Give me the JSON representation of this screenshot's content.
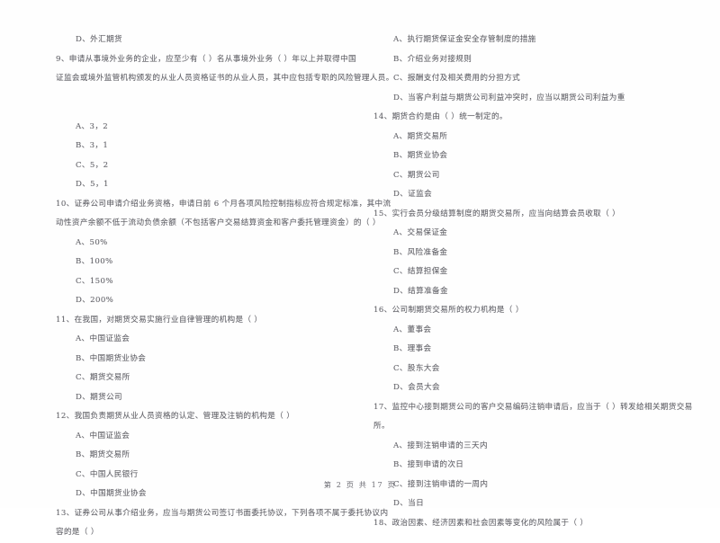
{
  "document": {
    "footer": "第 2 页 共 17 页"
  },
  "left_column": {
    "blocks": [
      {
        "kind": "option",
        "text": "D、外汇期货"
      },
      {
        "kind": "question",
        "text": "9、申请从事境外业务的企业，应至少有（      ）名从事境外业务（      ）年以上并取得中国"
      },
      {
        "kind": "cont",
        "text": "证监会或境外监管机构颁发的从业人员资格证书的从业人员，其中应包括专职的风险管理人员。"
      },
      {
        "kind": "gap-lg",
        "text": ""
      },
      {
        "kind": "option",
        "text": "A、3，2"
      },
      {
        "kind": "option",
        "text": "B、3，1"
      },
      {
        "kind": "option",
        "text": "C、5，2"
      },
      {
        "kind": "option",
        "text": "D、5，1"
      },
      {
        "kind": "question",
        "text": "10、证券公司申请介绍业务资格，申请日前 6 个月各项风险控制指标应符合规定标准，其中流"
      },
      {
        "kind": "cont",
        "text": "动性资产余额不低于流动负债余额（不包括客户交易结算资金和客户委托管理资金）的（      ）"
      },
      {
        "kind": "option",
        "text": "A、50%"
      },
      {
        "kind": "option",
        "text": "B、100%"
      },
      {
        "kind": "option",
        "text": "C、150%"
      },
      {
        "kind": "option",
        "text": "D、200%"
      },
      {
        "kind": "question",
        "text": "11、在我国，对期货交易实施行业自律管理的机构是（      ）"
      },
      {
        "kind": "option",
        "text": "A、中国证监会"
      },
      {
        "kind": "option",
        "text": "B、中国期货业协会"
      },
      {
        "kind": "option",
        "text": "C、期货交易所"
      },
      {
        "kind": "option",
        "text": "D、期货公司"
      },
      {
        "kind": "question",
        "text": "12、我国负责期货从业人员资格的认定、管理及注销的机构是（      ）"
      },
      {
        "kind": "option",
        "text": "A、中国证监会"
      },
      {
        "kind": "option",
        "text": "B、期货交易所"
      },
      {
        "kind": "option",
        "text": "C、中国人民银行"
      },
      {
        "kind": "option",
        "text": "D、中国期货业协会"
      },
      {
        "kind": "question",
        "text": "13、证券公司从事介绍业务，应当与期货公司签订书面委托协议，下列各项不属于委托协议内"
      },
      {
        "kind": "cont",
        "text": "容的是（      ）"
      }
    ]
  },
  "right_column": {
    "blocks": [
      {
        "kind": "option",
        "text": "A、执行期货保证金安全存管制度的措施"
      },
      {
        "kind": "option",
        "text": "B、介绍业务对接规则"
      },
      {
        "kind": "option",
        "text": "C、报酬支付及相关费用的分担方式"
      },
      {
        "kind": "option",
        "text": "D、当客户利益与期货公司利益冲突时，应当以期货公司利益为重"
      },
      {
        "kind": "question",
        "text": "14、期货合约是由（      ）统一制定的。"
      },
      {
        "kind": "option",
        "text": "A、期货交易所"
      },
      {
        "kind": "option",
        "text": "B、期货业协会"
      },
      {
        "kind": "option",
        "text": "C、期货公司"
      },
      {
        "kind": "option",
        "text": "D、证监会"
      },
      {
        "kind": "question",
        "text": "15、实行会员分级结算制度的期货交易所，应当向结算会员收取（      ）"
      },
      {
        "kind": "option",
        "text": "A、交易保证金"
      },
      {
        "kind": "option",
        "text": "B、风险准备金"
      },
      {
        "kind": "option",
        "text": "C、结算担保金"
      },
      {
        "kind": "option",
        "text": "D、结算准备金"
      },
      {
        "kind": "question",
        "text": "16、公司制期货交易所的权力机构是（      ）"
      },
      {
        "kind": "option",
        "text": "A、董事会"
      },
      {
        "kind": "option",
        "text": "B、理事会"
      },
      {
        "kind": "option",
        "text": "C、股东大会"
      },
      {
        "kind": "option",
        "text": "D、会员大会"
      },
      {
        "kind": "question",
        "text": "17、监控中心接到期货公司的客户交易编码注销申请后，应当于（      ）转发给相关期货交易"
      },
      {
        "kind": "cont",
        "text": "所。"
      },
      {
        "kind": "option",
        "text": "A、接到注销申请的三天内"
      },
      {
        "kind": "option",
        "text": "B、接到申请的次日"
      },
      {
        "kind": "option",
        "text": "C、接到注销申请的一周内"
      },
      {
        "kind": "option",
        "text": "D、当日"
      },
      {
        "kind": "question",
        "text": "18、政治因素、经济因素和社会因素等变化的风险属于（      ）"
      }
    ]
  }
}
